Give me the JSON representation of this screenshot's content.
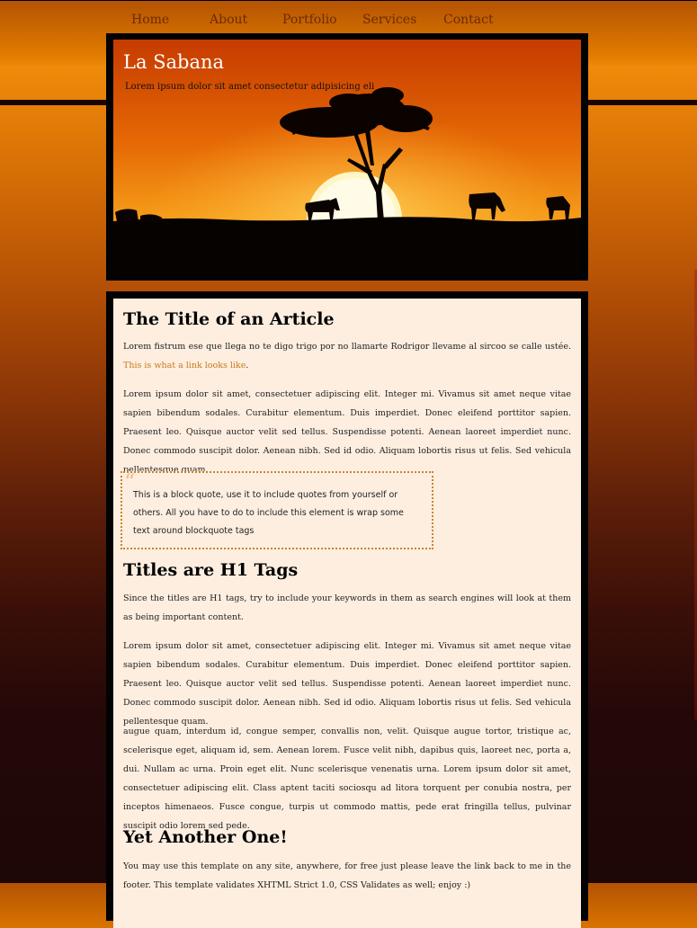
{
  "nav": {
    "items": [
      {
        "label": "Home"
      },
      {
        "label": "About"
      },
      {
        "label": "Portfolio"
      },
      {
        "label": "Services"
      },
      {
        "label": "Contact"
      }
    ]
  },
  "header": {
    "title": "La Sabana",
    "tagline": "Lorem ipsum dolor sit amet consectetur adipisicing eli",
    "image": "savanna-sunset-acacia-wildebeest"
  },
  "article": {
    "title": "The Title of an Article",
    "intro": "Lorem fistrum ese que llega no te digo trigo por no llamarte Rodrigor llevame al sircoo se calle ustée.",
    "link_label": "This is what a link looks like",
    "link_suffix": ".",
    "paragraph1": "Lorem ipsum dolor sit amet, consectetuer adipiscing elit. Integer mi. Vivamus sit amet neque vitae sapien bibendum sodales. Curabitur elementum. Duis imperdiet. Donec eleifend porttitor sapien. Praesent leo. Quisque auctor velit sed tellus. Suspendisse potenti. Aenean laoreet imperdiet nunc. Donec commodo suscipit dolor. Aenean nibh. Sed id odio. Aliquam lobortis risus ut felis. Sed vehicula pellentesque quam.",
    "blockquote": "This is a block quote, use it to include quotes from yourself or others. All you have to do to include this element is wrap some text around blockquote tags",
    "section2_title": "Titles are H1 Tags",
    "section2_p1": "Since the titles are H1 tags, try to include your keywords in them as search engines will look at them as being important content.",
    "section2_p2": "Lorem ipsum dolor sit amet, consectetuer adipiscing elit. Integer mi. Vivamus sit amet neque vitae sapien bibendum sodales. Curabitur elementum. Duis imperdiet. Donec eleifend porttitor sapien. Praesent leo. Quisque auctor velit sed tellus. Suspendisse potenti. Aenean laoreet imperdiet nunc. Donec commodo suscipit dolor. Aenean nibh. Sed id odio. Aliquam lobortis risus ut felis. Sed vehicula pellentesque quam.",
    "section2_p3": "augue quam, interdum id, congue semper, convallis non, velit. Quisque augue tortor, tristique ac, scelerisque eget, aliquam id, sem. Aenean lorem. Fusce velit nibh, dapibus quis, laoreet nec, porta a, dui. Nullam ac urna. Proin eget elit. Nunc scelerisque venenatis urna. Lorem ipsum dolor sit amet, consectetuer adipiscing elit. Class aptent taciti sociosqu ad litora torquent per conubia nostra, per inceptos himenaeos. Fusce congue, turpis ut commodo mattis, pede erat fringilla tellus, pulvinar suscipit odio lorem sed pede.",
    "section3_title": "Yet Another One!",
    "section3_p1": "You may use this template on any site, anywhere, for free just please leave the link back to me in the footer. This template validates XHTML Strict 1.0, CSS Validates as well; enjoy :)"
  },
  "colors": {
    "link": "#c87a1a",
    "content_bg": "#fdeee0",
    "frame": "#020202",
    "quote_border": "#c8862a"
  }
}
